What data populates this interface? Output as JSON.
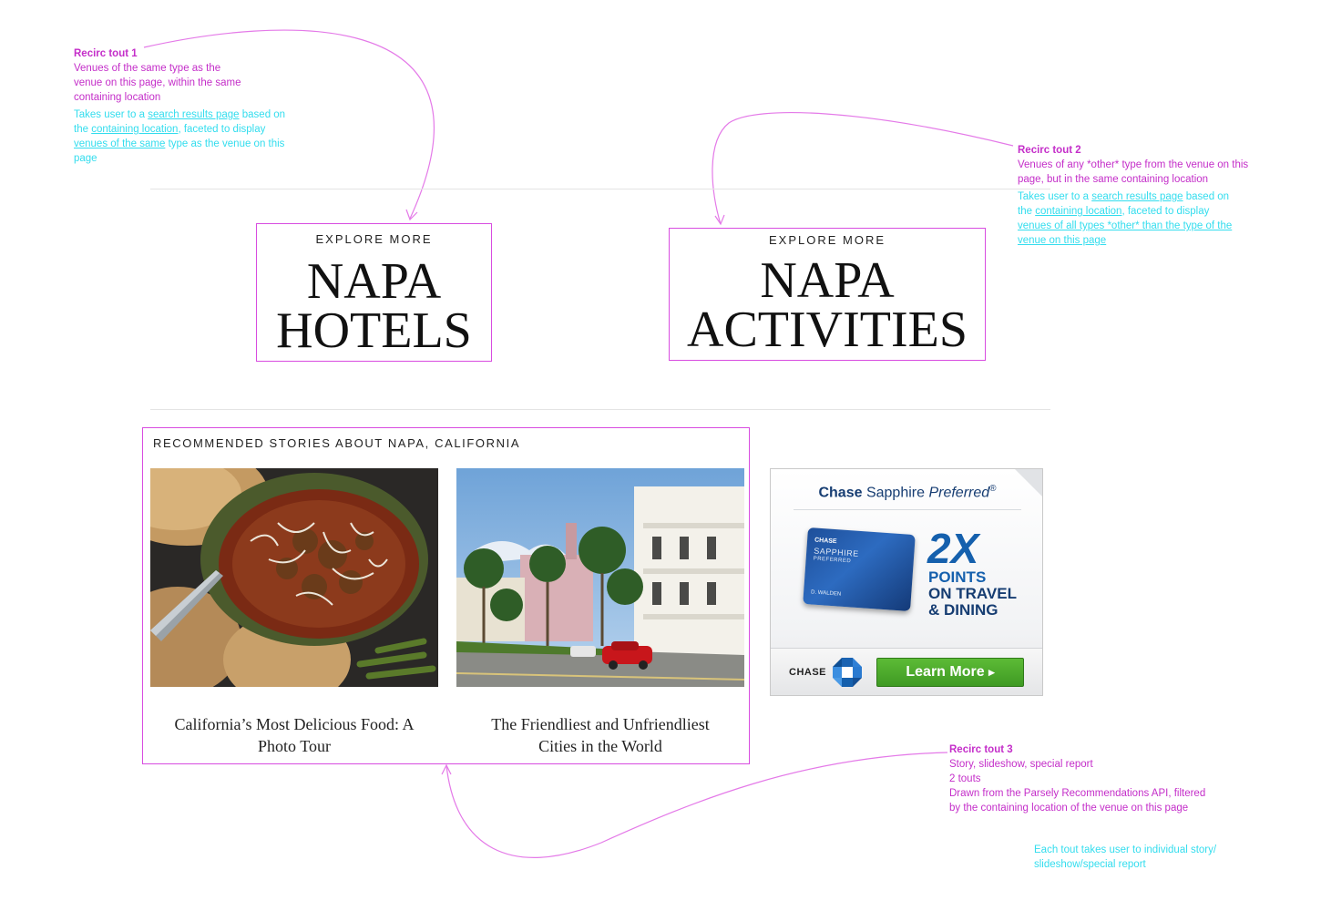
{
  "notes": {
    "tout1": {
      "title": "Recirc tout 1",
      "lines": [
        "Venues of the same type as the",
        "venue on this page, within the same",
        "containing location"
      ],
      "link_text": {
        "p1": "Takes user to a ",
        "l1": "search results page",
        "p2": " based on the ",
        "l2": "containing location",
        "p3": ", faceted to display ",
        "l3": "venues of the same",
        "p4": " type as the venue on this page"
      }
    },
    "tout2": {
      "title": "Recirc tout 2",
      "lines": [
        "Venues of any *other* type from the venue on this",
        "page, but in the same containing location"
      ],
      "link_text": {
        "p1": "Takes user to a ",
        "l1": "search results page",
        "p2": " based on the ",
        "l2": "containing location",
        "p3": ", faceted to display ",
        "l3": "venues of all types *other* than the type of the venue on this page"
      }
    },
    "tout3": {
      "title": "Recirc tout 3",
      "lines": [
        "Story, slideshow, special report",
        "2 touts",
        "Drawn from the Parsely Recommendations API, filtered",
        "by the containing location of the venue on this page"
      ],
      "cyan": "Each tout takes user to individual story/ slideshow/special report"
    }
  },
  "explore": [
    {
      "eyebrow": "EXPLORE MORE",
      "line1": "NAPA",
      "line2": "HOTELS"
    },
    {
      "eyebrow": "EXPLORE MORE",
      "line1": "NAPA",
      "line2": "ACTIVITIES"
    }
  ],
  "recommended": {
    "heading": "RECOMMENDED STORIES ABOUT NAPA, CALIFORNIA",
    "stories": [
      {
        "caption": "California’s Most Delicious Food: A Photo Tour"
      },
      {
        "caption": "The Friendliest and Unfriendliest Cities in the World"
      }
    ]
  },
  "ad": {
    "brand": "Chase",
    "product": "Sapphire",
    "product_italic": "Preferred",
    "reg": "®",
    "card_chase": "CHASE",
    "card_line1": "SAPPHIRE",
    "card_line2": "PREFERRED",
    "card_name": "D. WALDEN",
    "big": "2X",
    "line1": "POINTS",
    "line2": "ON TRAVEL",
    "line3": "& DINING",
    "logo_text": "CHASE",
    "cta": "Learn More",
    "cta_arrow": "▸"
  },
  "colors": {
    "annotation_magenta": "#c42ec9",
    "annotation_cyan": "#33ddee",
    "chase_blue": "#1560ad",
    "cta_green": "#3f9a23"
  }
}
